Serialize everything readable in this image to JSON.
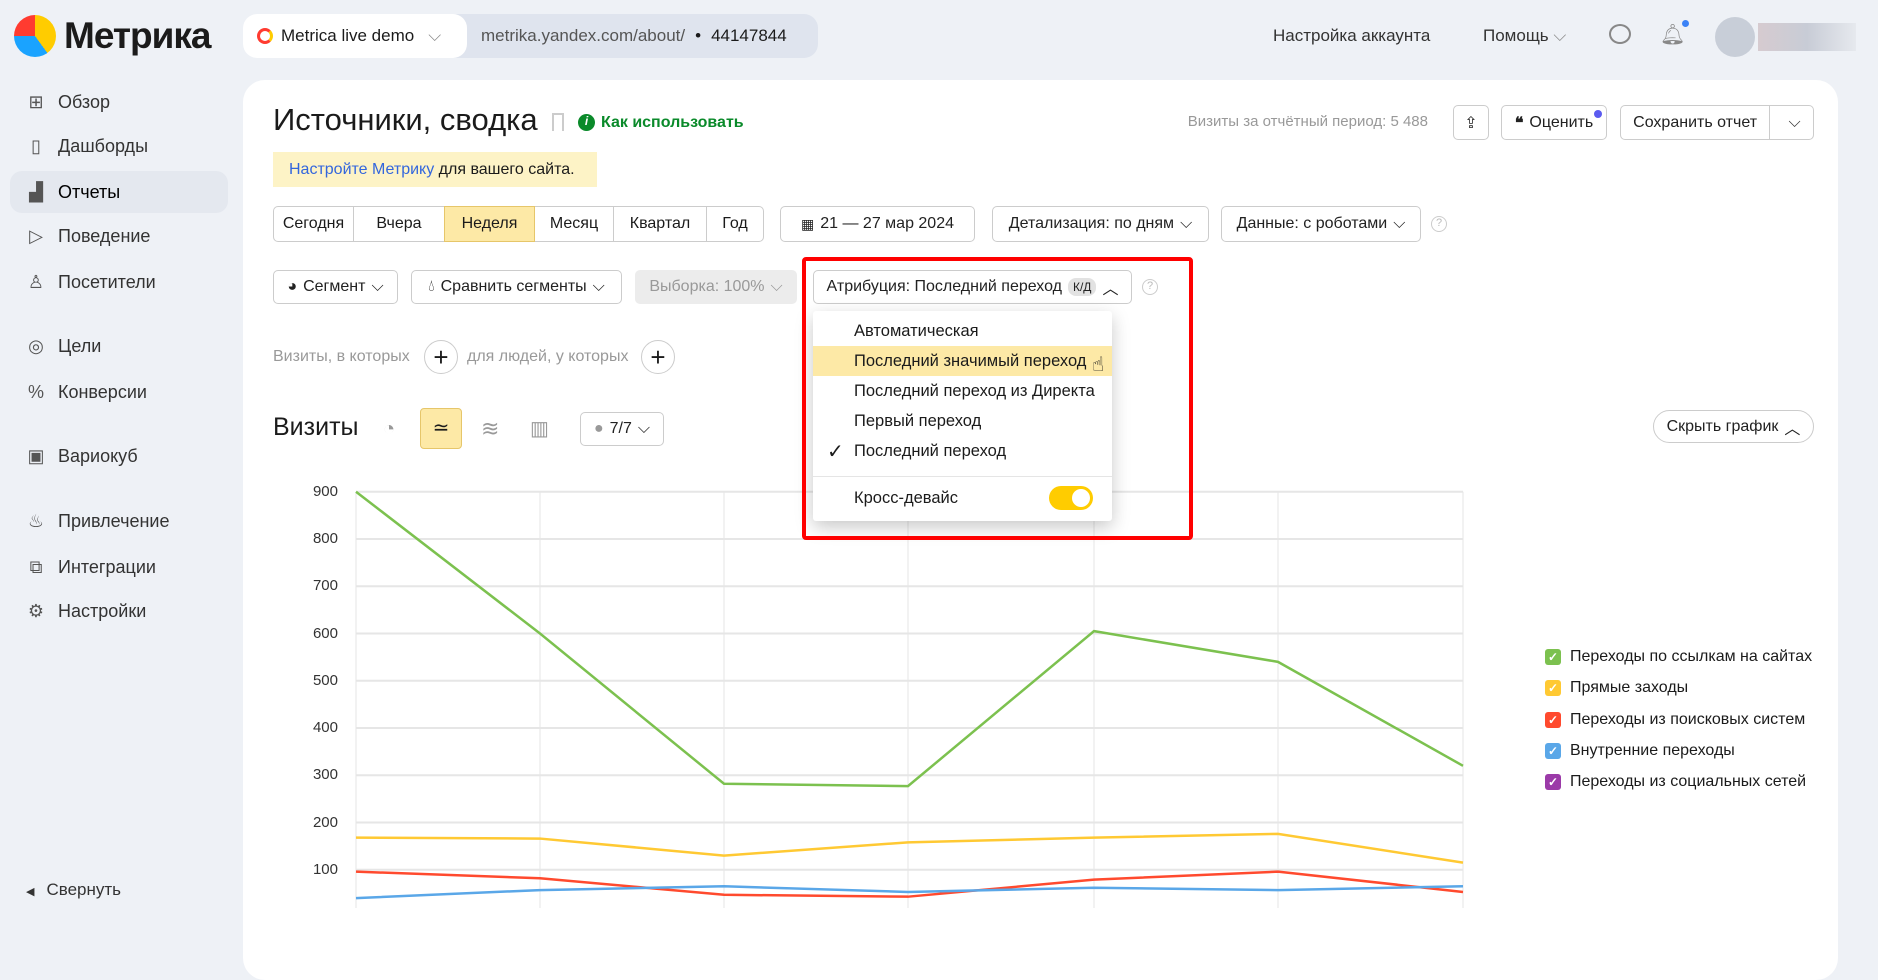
{
  "app": {
    "logo": "Метрика"
  },
  "sidebar": {
    "items": [
      {
        "label": "Обзор",
        "icon": "grid-icon"
      },
      {
        "label": "Дашборды",
        "icon": "dashboards-icon"
      },
      {
        "label": "Отчеты",
        "icon": "bar-chart-icon",
        "active": true
      },
      {
        "label": "Поведение",
        "icon": "play-icon"
      },
      {
        "label": "Посетители",
        "icon": "user-icon"
      },
      {
        "label": "Цели",
        "icon": "target-icon"
      },
      {
        "label": "Конверсии",
        "icon": "percent-icon"
      },
      {
        "label": "Вариокуб",
        "icon": "cube-icon"
      },
      {
        "label": "Привлечение",
        "icon": "fire-icon"
      },
      {
        "label": "Интеграции",
        "icon": "puzzle-icon"
      },
      {
        "label": "Настройки",
        "icon": "gear-icon"
      }
    ],
    "collapse": "Свернуть"
  },
  "topbar": {
    "counter_name": "Metrica live demo",
    "site": "metrika.yandex.com/about/",
    "counter_id": "44147844",
    "account_settings": "Настройка аккаунта",
    "help": "Помощь"
  },
  "report": {
    "title": "Источники, сводка",
    "how_to": "Как использовать",
    "notice_link": "Настройте Метрику",
    "notice_text": " для вашего сайта.",
    "visits_total": "Визиты за отчётный период: 5 488",
    "rate": "Оценить",
    "save": "Сохранить отчет"
  },
  "periods": [
    {
      "label": "Сегодня"
    },
    {
      "label": "Вчера"
    },
    {
      "label": "Неделя",
      "active": true
    },
    {
      "label": "Месяц"
    },
    {
      "label": "Квартал"
    },
    {
      "label": "Год"
    }
  ],
  "date_range": "21 — 27 мар 2024",
  "detail": "Детализация: по дням",
  "data_filter": "Данные: с роботами",
  "segment": "Сегмент",
  "compare": "Сравнить сегменты",
  "sample": "Выборка: 100%",
  "attribution": {
    "label": "Атрибуция: Последний переход",
    "badge": "К/Д",
    "options": [
      {
        "label": "Автоматическая"
      },
      {
        "label": "Последний значимый переход",
        "hovered": true
      },
      {
        "label": "Последний переход из Директа"
      },
      {
        "label": "Первый переход"
      },
      {
        "label": "Последний переход",
        "checked": true
      }
    ],
    "cross_device": "Кросс-девайс",
    "cross_device_on": true
  },
  "filters": {
    "visits": "Визиты, в которых",
    "people": "для людей, у которых"
  },
  "chart_header": {
    "title": "Визиты",
    "series_count": "7/7",
    "hide": "Скрыть график"
  },
  "chart_data": {
    "type": "line",
    "ylim": [
      0,
      900
    ],
    "yticks": [
      100,
      200,
      300,
      400,
      500,
      600,
      700,
      800,
      900
    ],
    "grid": true,
    "legend": "right",
    "series": [
      {
        "name": "Переходы по ссылкам на сайтах",
        "color": "#7cc14f",
        "values": [
          900,
          600,
          282,
          277,
          605,
          540,
          320
        ]
      },
      {
        "name": "Прямые заходы",
        "color": "#ffc933",
        "values": [
          168,
          166,
          130,
          158,
          168,
          176,
          115
        ]
      },
      {
        "name": "Переходы из поисковых систем",
        "color": "#ff4a2e",
        "values": [
          96,
          82,
          47,
          43,
          79,
          96,
          53
        ]
      },
      {
        "name": "Внутренние переходы",
        "color": "#5aa7e8",
        "values": [
          40,
          57,
          65,
          53,
          62,
          57,
          65
        ]
      },
      {
        "name": "Переходы из социальных сетей",
        "color": "#9b3aa8",
        "values": []
      }
    ]
  }
}
